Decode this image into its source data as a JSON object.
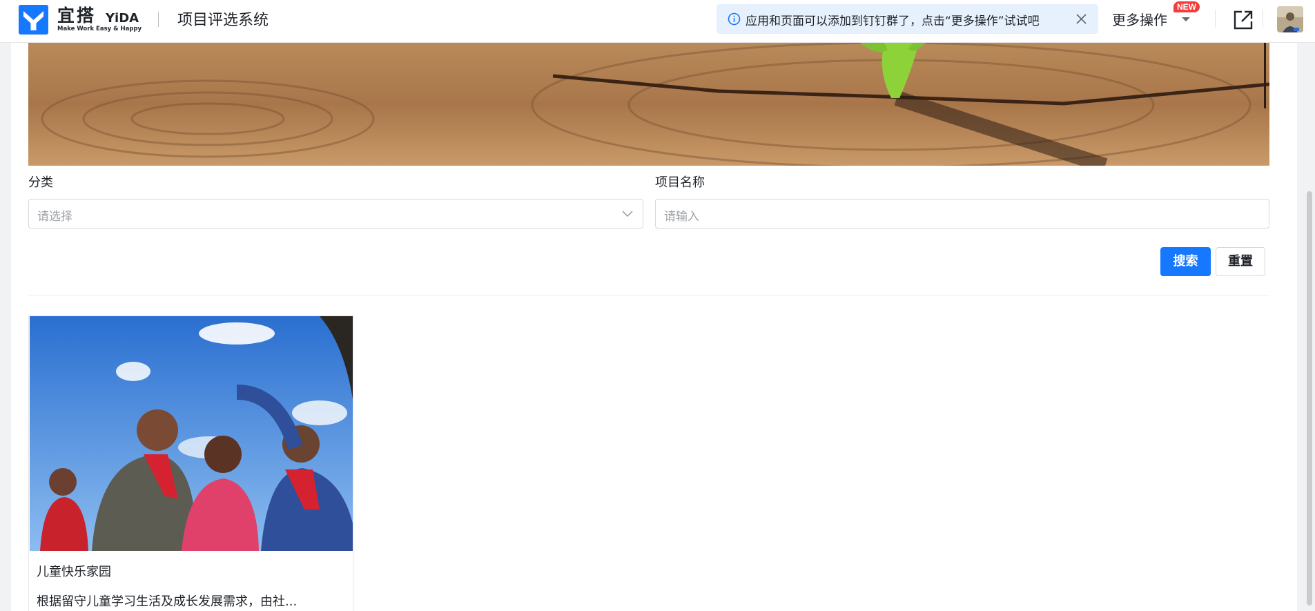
{
  "header": {
    "logo_cn": "宜搭",
    "logo_en": "YiDA",
    "logo_tagline": "Make Work Easy & Happy",
    "app_title": "项目评选系统",
    "notice_text": "应用和页面可以添加到钉钉群了，点击“更多操作”试试吧",
    "more_ops_label": "更多操作",
    "new_badge": "NEW"
  },
  "filters": {
    "category": {
      "label": "分类",
      "placeholder": "请选择"
    },
    "project_name": {
      "label": "项目名称",
      "placeholder": "请输入"
    }
  },
  "actions": {
    "search_label": "搜索",
    "reset_label": "重置"
  },
  "cards": [
    {
      "title": "儿童快乐家园",
      "description": "根据留守儿童学习生活及成长发展需求，由社..."
    }
  ],
  "colors": {
    "primary": "#1677ff",
    "notice_bg": "#e6f1fd",
    "badge": "#f23d3d"
  },
  "icons": [
    "yida-logo-icon",
    "info-icon",
    "close-icon",
    "caret-down-icon",
    "share-external-icon",
    "chevron-down-icon"
  ]
}
